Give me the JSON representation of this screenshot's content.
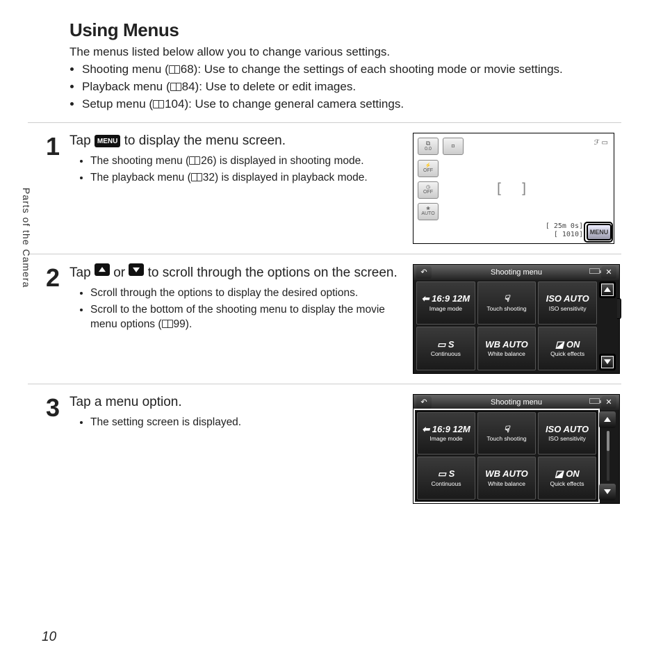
{
  "heading": "Using Menus",
  "intro": "The menus listed below allow you to change various settings.",
  "bullets": {
    "b0a": "Shooting menu (",
    "b0ref": "68",
    "b0b": "): Use to change the settings of each shooting mode or movie settings.",
    "b1a": "Playback menu (",
    "b1ref": "84",
    "b1b": "): Use to delete or edit images.",
    "b2a": "Setup menu (",
    "b2ref": "104",
    "b2b": "): Use to change general camera settings."
  },
  "steps": {
    "s1": {
      "num": "1",
      "title_a": "Tap ",
      "title_icon": "MENU",
      "title_b": " to display the menu screen.",
      "sub0a": "The shooting menu (",
      "sub0ref": "26",
      "sub0b": ") is displayed in shooting mode.",
      "sub1a": "The playback menu (",
      "sub1ref": "32",
      "sub1b": ") is displayed in playback mode."
    },
    "s2": {
      "num": "2",
      "title_a": "Tap ",
      "title_mid": " or ",
      "title_b": " to scroll through the options on the screen.",
      "sub0": "Scroll through the options to display the desired options.",
      "sub1a": "Scroll to the bottom of the shooting menu to display the movie menu options (",
      "sub1ref": "99",
      "sub1b": ")."
    },
    "s3": {
      "num": "3",
      "title": "Tap a menu option.",
      "sub0": "The setting screen is displayed."
    }
  },
  "fig1": {
    "ev": "0.0",
    "flash_off": "OFF",
    "timer_off": "OFF",
    "macro": "AUTO",
    "cam_icon": "◘",
    "top_right": "ℱ ▭",
    "af": "[    ]",
    "time": "[ 25m 0s]",
    "shots": "[ 1010]",
    "menu": "MENU"
  },
  "shooting_menu": {
    "title": "Shooting menu",
    "back": "↶",
    "close": "✕",
    "cells": {
      "c0": {
        "icon": "⬅ 16:9 12M",
        "label": "Image mode"
      },
      "c1": {
        "icon": "☟",
        "label": "Touch shooting"
      },
      "c2": {
        "icon": "ISO AUTO",
        "label": "ISO sensitivity"
      },
      "c3": {
        "icon": "▭ S",
        "label": "Continuous"
      },
      "c4": {
        "icon": "WB AUTO",
        "label": "White balance"
      },
      "c5": {
        "icon": "◪ ON",
        "label": "Quick effects"
      }
    }
  },
  "side_label": "Parts of the Camera",
  "page_number": "10"
}
